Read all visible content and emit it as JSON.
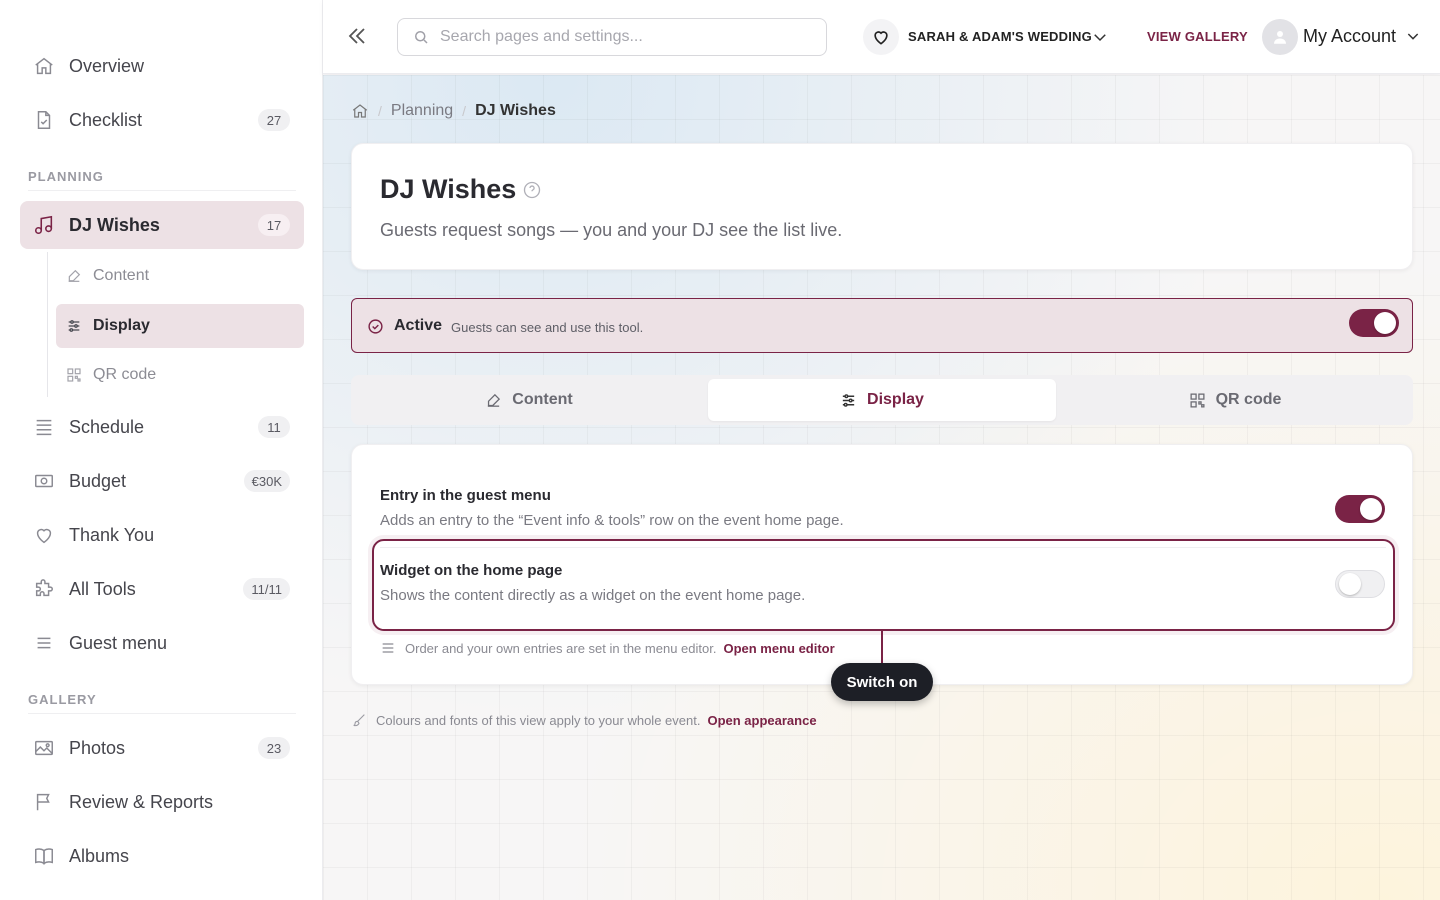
{
  "sidebar": {
    "top_items": [
      {
        "label": "Overview",
        "icon": "home-icon"
      },
      {
        "label": "Checklist",
        "icon": "checklist-icon",
        "badge": "27"
      }
    ],
    "planning_section": "PLANNING",
    "dj_wishes": {
      "label": "DJ Wishes",
      "badge": "17",
      "icon": "music-note-icon"
    },
    "sub_items": [
      {
        "label": "Content",
        "icon": "edit-icon"
      },
      {
        "label": "Display",
        "icon": "sliders-icon"
      },
      {
        "label": "QR code",
        "icon": "qr-code-icon"
      }
    ],
    "planning_items": [
      {
        "label": "Schedule",
        "icon": "list-icon",
        "badge": "11"
      },
      {
        "label": "Budget",
        "icon": "money-icon",
        "badge": "€30K"
      },
      {
        "label": "Thank You",
        "icon": "heart-icon"
      },
      {
        "label": "All Tools",
        "icon": "puzzle-icon",
        "badge": "11/11"
      },
      {
        "label": "Guest menu",
        "icon": "menu-icon"
      }
    ],
    "gallery_section": "GALLERY",
    "gallery_items": [
      {
        "label": "Photos",
        "icon": "image-icon",
        "badge": "23"
      },
      {
        "label": "Review & Reports",
        "icon": "flag-icon"
      },
      {
        "label": "Albums",
        "icon": "book-icon"
      }
    ]
  },
  "topbar": {
    "search_placeholder": "Search pages and settings...",
    "search_value": "",
    "event_name": "SARAH & ADAM'S WEDDING",
    "view_gallery": "VIEW GALLERY",
    "account_label": "My Account"
  },
  "breadcrumb": {
    "parent": "Planning",
    "current": "DJ Wishes"
  },
  "header": {
    "title": "DJ Wishes",
    "description": "Guests request songs — you and your DJ see the list live."
  },
  "status": {
    "title": "Active",
    "description": "Guests can see and use this tool.",
    "enabled": true
  },
  "tabs": [
    {
      "label": "Content",
      "icon": "edit-icon"
    },
    {
      "label": "Display",
      "icon": "sliders-icon",
      "active": true
    },
    {
      "label": "QR code",
      "icon": "qr-code-icon"
    }
  ],
  "settings": {
    "guest_menu_entry": {
      "title": "Entry in the guest menu",
      "description": "Adds an entry to the “Event info & tools” row on the event home page.",
      "enabled": true
    },
    "home_widget": {
      "title": "Widget on the home page",
      "description": "Shows the content directly as a widget on the event home page.",
      "enabled": false
    },
    "menu_note": "Order and your own entries are set in the menu editor.",
    "menu_note_link": "Open menu editor"
  },
  "tooltip": "Switch on",
  "footnote": {
    "text": "Colours and fonts of this view apply to your whole event.",
    "link": "Open appearance"
  },
  "colors": {
    "accent": "#7a2346",
    "active_bg": "#ede1e5",
    "tooltip_bg": "#1d1f26"
  }
}
